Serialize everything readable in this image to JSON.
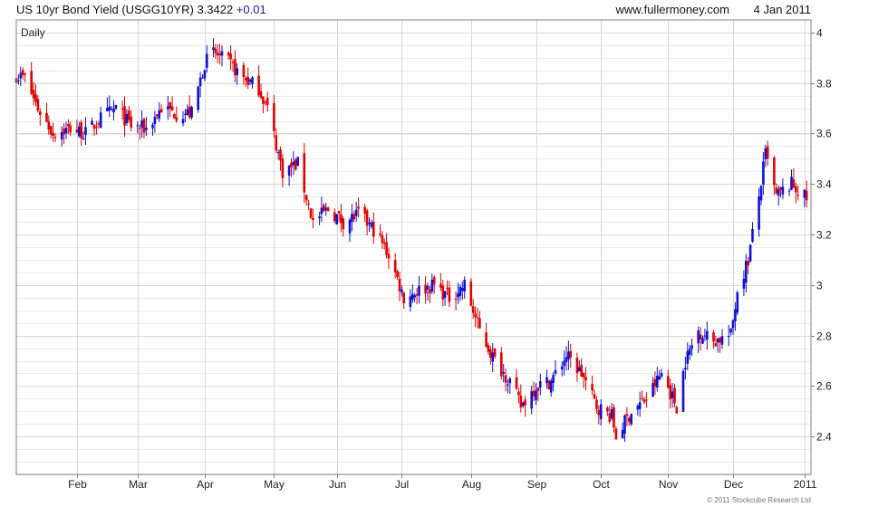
{
  "header": {
    "title": "US 10yr Bond Yield (USGG10YR)",
    "last_value": "3.3422",
    "change": "+0.01",
    "site": "www.fullermoney.com",
    "date": "4 Jan 2011"
  },
  "period_label": "Daily",
  "copyright": "© 2011 Stockcube Research Ltd",
  "colors": {
    "up": "#1010d8",
    "down": "#e00000",
    "grid": "#d6d6d6",
    "frame": "#808080",
    "accent": "#1a1aa8"
  },
  "chart_data": {
    "type": "candlestick",
    "x_tick_labels": [
      "Feb",
      "Mar",
      "Apr",
      "May",
      "Jun",
      "Jul",
      "Aug",
      "Sep",
      "Oct",
      "Nov",
      "Dec",
      "2011"
    ],
    "x_tick_dates": [
      "2010-02-01",
      "2010-03-01",
      "2010-04-01",
      "2010-05-03",
      "2010-06-01",
      "2010-07-01",
      "2010-08-02",
      "2010-09-01",
      "2010-10-01",
      "2010-11-01",
      "2010-12-01",
      "2011-01-03"
    ],
    "x_range": [
      "2010-01-04",
      "2011-01-06"
    ],
    "y_ticks": [
      2.4,
      2.6,
      2.8,
      3,
      3.2,
      3.4,
      3.6,
      3.8,
      4
    ],
    "y_tick_labels": [
      "2.4",
      "2.6",
      "2.8",
      "3",
      "3.2",
      "3.4",
      "3.6",
      "3.8",
      "4"
    ],
    "ylim": [
      2.25,
      4.05
    ],
    "y_axis_side": "right",
    "grid": true,
    "close_path_dates": [
      "2010-01-04",
      "2010-01-08",
      "2010-01-14",
      "2010-01-21",
      "2010-01-29",
      "2010-02-05",
      "2010-02-12",
      "2010-02-19",
      "2010-02-26",
      "2010-03-05",
      "2010-03-12",
      "2010-03-19",
      "2010-03-26",
      "2010-04-01",
      "2010-04-05",
      "2010-04-12",
      "2010-04-19",
      "2010-04-26",
      "2010-04-30",
      "2010-05-07",
      "2010-05-14",
      "2010-05-21",
      "2010-05-28",
      "2010-06-04",
      "2010-06-11",
      "2010-06-18",
      "2010-06-25",
      "2010-07-02",
      "2010-07-09",
      "2010-07-16",
      "2010-07-23",
      "2010-07-30",
      "2010-08-06",
      "2010-08-13",
      "2010-08-20",
      "2010-08-25",
      "2010-09-01",
      "2010-09-08",
      "2010-09-15",
      "2010-09-22",
      "2010-09-29",
      "2010-10-06",
      "2010-10-08",
      "2010-10-15",
      "2010-10-22",
      "2010-10-29",
      "2010-11-05",
      "2010-11-09",
      "2010-11-15",
      "2010-11-22",
      "2010-11-30",
      "2010-12-03",
      "2010-12-08",
      "2010-12-13",
      "2010-12-16",
      "2010-12-21",
      "2010-12-28",
      "2011-01-04"
    ],
    "close_path_values": [
      3.83,
      3.82,
      3.7,
      3.6,
      3.62,
      3.6,
      3.66,
      3.7,
      3.63,
      3.62,
      3.7,
      3.68,
      3.68,
      3.88,
      3.92,
      3.88,
      3.82,
      3.78,
      3.7,
      3.45,
      3.48,
      3.25,
      3.3,
      3.25,
      3.28,
      3.22,
      3.12,
      2.95,
      2.98,
      3.0,
      2.95,
      3.0,
      2.82,
      2.7,
      2.62,
      2.52,
      2.6,
      2.62,
      2.72,
      2.65,
      2.52,
      2.48,
      2.4,
      2.5,
      2.55,
      2.65,
      2.52,
      2.7,
      2.82,
      2.78,
      2.8,
      2.98,
      3.1,
      3.35,
      3.52,
      3.35,
      3.4,
      3.34
    ]
  }
}
